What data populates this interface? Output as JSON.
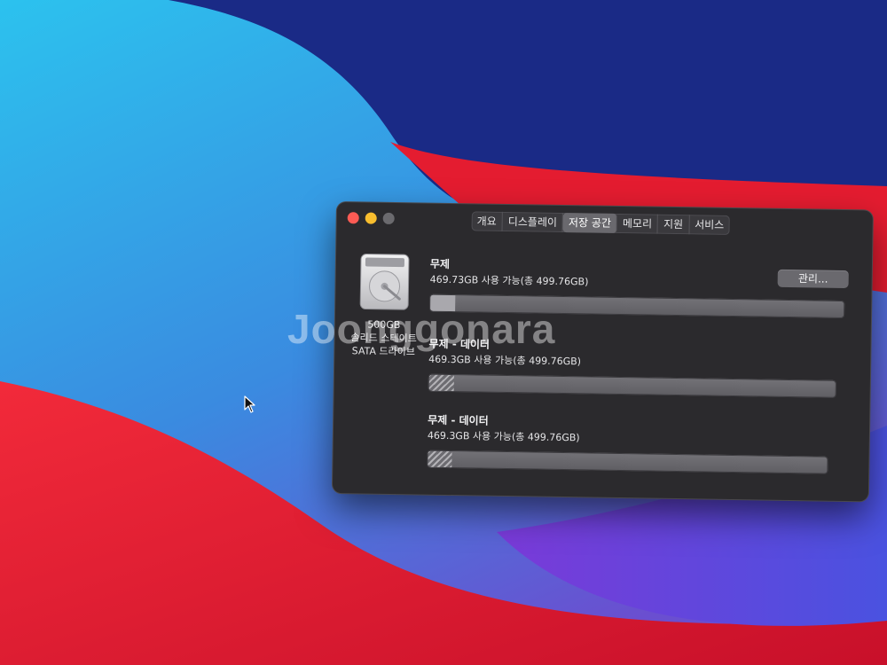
{
  "window": {
    "tabs": [
      {
        "label": "개요"
      },
      {
        "label": "디스플레이"
      },
      {
        "label": "저장 공간",
        "active": true
      },
      {
        "label": "메모리"
      },
      {
        "label": "지원"
      },
      {
        "label": "서비스"
      }
    ],
    "drive": {
      "capacity": "500GB",
      "type_line1": "솔리드 스테이트",
      "type_line2": "SATA 드라이브",
      "icon": "hard-drive-icon"
    },
    "manage_label": "관리...",
    "volumes": [
      {
        "name": "무제",
        "info": "469.73GB 사용 가능(총 499.76GB)",
        "used_fraction": 0.06
      },
      {
        "name": "무제 - 데이터",
        "info": "469.3GB 사용 가능(총 499.76GB)",
        "used_fraction": 0.06
      },
      {
        "name": "무제 - 데이터",
        "info": "469.3GB 사용 가능(총 499.76GB)",
        "used_fraction": 0.06
      }
    ]
  },
  "watermark": "Joonggonara",
  "colors": {
    "close": "#fd5b54",
    "minimize": "#f8bd2e",
    "window_bg": "#2b2a2d",
    "wallpaper_blue": "#1c2f8f",
    "wallpaper_cyan": "#29b6e8",
    "wallpaper_red": "#e8142c"
  }
}
